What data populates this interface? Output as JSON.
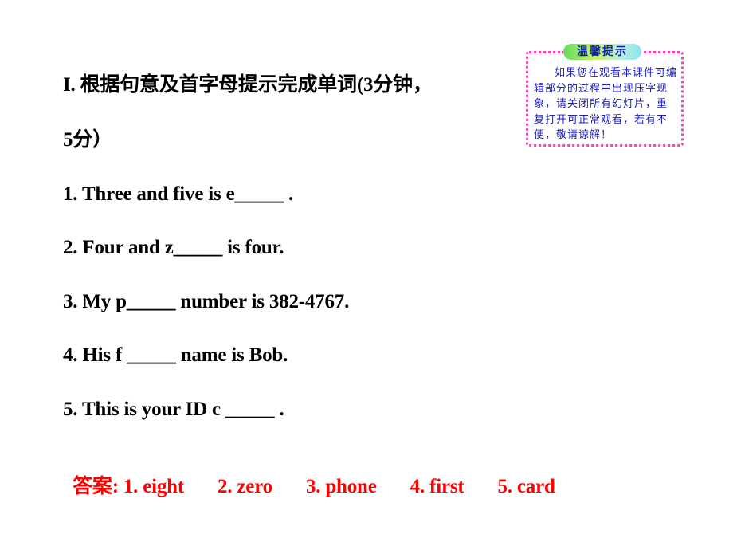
{
  "exercise": {
    "title_line1": "I. 根据句意及首字母提示完成单词(3分钟，",
    "title_line2": "5分）",
    "questions": [
      "1. Three and five is e_____ .",
      "2. Four and z_____ is four.",
      "3. My p_____ number is 382-4767.",
      "4. His f _____ name is Bob.",
      "5. This is your ID c _____ ."
    ],
    "answers": {
      "label": "答案:",
      "items": [
        "1. eight",
        "2. zero",
        "3. phone",
        "4. first",
        "5. card"
      ],
      "color": "#ff0000"
    }
  },
  "tip": {
    "badge": "温馨提示",
    "text": "如果您在观看本课件可编辑部分的过程中出现压字现象，请关闭所有幻灯片，重复打开可正常观看，若有不便，敬请谅解！",
    "border_color": "#ff3fb4",
    "text_color": "#2020c0"
  }
}
